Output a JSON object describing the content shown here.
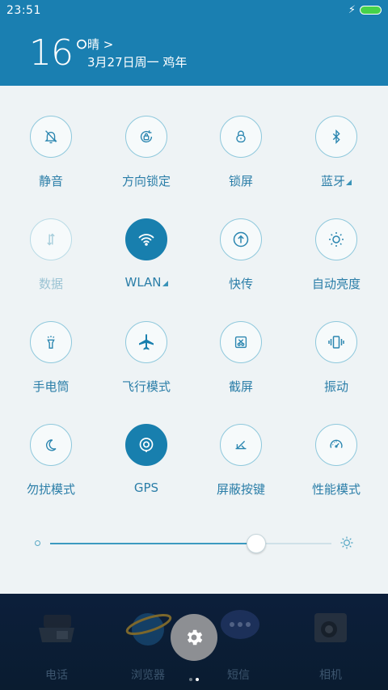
{
  "status": {
    "time": "23:51"
  },
  "weather": {
    "temperature": "16°",
    "condition": "晴 >",
    "date": "3月27日周一  鸡年"
  },
  "toggles": [
    {
      "label": "静音",
      "icon": "silent-bell-icon",
      "state": "off"
    },
    {
      "label": "方向锁定",
      "icon": "rotation-lock-icon",
      "state": "off"
    },
    {
      "label": "锁屏",
      "icon": "lock-icon",
      "state": "off"
    },
    {
      "label": "蓝牙",
      "icon": "bluetooth-icon",
      "state": "off",
      "has_submenu": true
    },
    {
      "label": "数据",
      "icon": "mobile-data-icon",
      "state": "disabled"
    },
    {
      "label": "WLAN",
      "icon": "wifi-icon",
      "state": "on",
      "has_submenu": true
    },
    {
      "label": "快传",
      "icon": "quick-transfer-icon",
      "state": "off"
    },
    {
      "label": "自动亮度",
      "icon": "auto-brightness-icon",
      "state": "off"
    },
    {
      "label": "手电筒",
      "icon": "flashlight-icon",
      "state": "off"
    },
    {
      "label": "飞行模式",
      "icon": "airplane-icon",
      "state": "off"
    },
    {
      "label": "截屏",
      "icon": "screenshot-icon",
      "state": "off"
    },
    {
      "label": "振动",
      "icon": "vibrate-icon",
      "state": "off"
    },
    {
      "label": "勿扰模式",
      "icon": "moon-icon",
      "state": "off"
    },
    {
      "label": "GPS",
      "icon": "gps-icon",
      "state": "on"
    },
    {
      "label": "屏蔽按键",
      "icon": "block-keys-icon",
      "state": "off"
    },
    {
      "label": "性能模式",
      "icon": "speedometer-icon",
      "state": "off"
    }
  ],
  "brightness": {
    "level": 0.73
  },
  "dock": {
    "apps": [
      {
        "label": "电话",
        "icon": "phone-app-icon"
      },
      {
        "label": "浏览器",
        "icon": "browser-app-icon"
      },
      {
        "label": "短信",
        "icon": "messages-app-icon"
      },
      {
        "label": "相机",
        "icon": "camera-app-icon"
      }
    ],
    "settings_icon": "gear-icon",
    "page_indicator": {
      "pages": 2,
      "current": 2
    }
  },
  "colors": {
    "header_bg": "#1a7fb1",
    "accent": "#187fae",
    "panel_bg": "#eef3f5",
    "battery": "#46d24a"
  }
}
